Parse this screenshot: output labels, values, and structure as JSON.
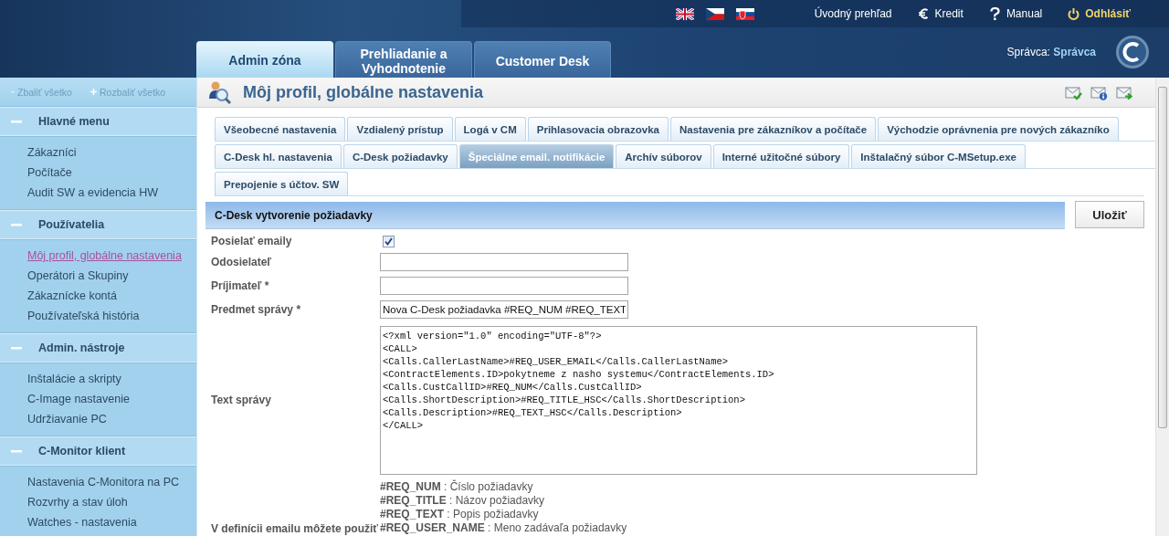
{
  "top_links": [
    {
      "label": "Úvodný prehľad",
      "kind": "plain"
    },
    {
      "label": "Kredit",
      "kind": "euro"
    },
    {
      "label": "Manual",
      "kind": "help"
    },
    {
      "label": "Odhlásiť",
      "kind": "logout"
    }
  ],
  "main_tabs": [
    {
      "label": "Admin zóna",
      "selected": true
    },
    {
      "label": "Prehliadanie a Vyhodnotenie",
      "selected": false
    },
    {
      "label": "Customer Desk",
      "selected": false
    }
  ],
  "user": {
    "role": "Správca:",
    "name": "Správca"
  },
  "sidebar": {
    "collapse_all": "Zbaliť všetko",
    "expand_all": "Rozbaliť všetko",
    "sections": [
      {
        "title": "Hlavné menu",
        "expanded": true,
        "items": [
          {
            "label": "Zákazníci",
            "selected": false
          },
          {
            "label": "Počítače",
            "selected": false
          },
          {
            "label": "Audit SW a evidencia HW",
            "selected": false
          }
        ]
      },
      {
        "title": "Používatelia",
        "expanded": true,
        "items": [
          {
            "label": "Môj profil, globálne nastavenia",
            "selected": true
          },
          {
            "label": "Operátori a Skupiny",
            "selected": false
          },
          {
            "label": "Zákaznícke kontá",
            "selected": false
          },
          {
            "label": "Používateľská história",
            "selected": false
          }
        ]
      },
      {
        "title": "Admin. nástroje",
        "expanded": true,
        "items": [
          {
            "label": "Inštalácie a skripty",
            "selected": false
          },
          {
            "label": "C-Image nastavenie",
            "selected": false
          },
          {
            "label": "Udržiavanie PC",
            "selected": false
          }
        ]
      },
      {
        "title": "C-Monitor klient",
        "expanded": true,
        "items": [
          {
            "label": "Nastavenia C-Monitora na PC",
            "selected": false
          },
          {
            "label": "Rozvrhy a stav úloh",
            "selected": false
          },
          {
            "label": "Watches - nastavenia",
            "selected": false
          }
        ]
      }
    ]
  },
  "page": {
    "title": "Môj profil, globálne nastavenia",
    "tab_rows": [
      [
        {
          "label": "Všeobecné nastavenia",
          "selected": false
        },
        {
          "label": "Vzdialený prístup",
          "selected": false
        },
        {
          "label": "Logá v CM",
          "selected": false
        },
        {
          "label": "Prihlasovacia obrazovka",
          "selected": false
        },
        {
          "label": "Nastavenia pre zákazníkov a počítače",
          "selected": false
        },
        {
          "label": "Východzie oprávnenia pre nových zákazníko",
          "selected": false
        }
      ],
      [
        {
          "label": "C-Desk hl. nastavenia",
          "selected": false
        },
        {
          "label": "C-Desk požiadavky",
          "selected": false
        },
        {
          "label": "Špeciálne email. notifikácie",
          "selected": true
        },
        {
          "label": "Archív súborov",
          "selected": false
        },
        {
          "label": "Interné užitočné súbory",
          "selected": false
        },
        {
          "label": "Inštalačný súbor C-MSetup.exe",
          "selected": false
        }
      ],
      [
        {
          "label": "Prepojenie s účtov. SW",
          "selected": false
        }
      ]
    ],
    "section": {
      "title": "C-Desk vytvorenie požiadavky",
      "save": "Uložiť",
      "fields": [
        {
          "kind": "checkbox",
          "label": "Posielať emaily",
          "checked": true
        },
        {
          "kind": "text",
          "label": "Odosielateľ"
        },
        {
          "kind": "text",
          "label": "Príjimateľ *"
        },
        {
          "kind": "text",
          "label": "Predmet správy *",
          "value": "Nova C-Desk požiadavka #REQ_NUM #REQ_TEXT"
        },
        {
          "kind": "textarea",
          "label": "Text správy",
          "lines": [
            "<?xml version=\"1.0\" encoding=\"UTF-8\"?>",
            "<CALL>",
            "<Calls.CallerLastName>#REQ_USER_EMAIL</Calls.CallerLastName>",
            "<ContractElements.ID>pokytneme z nasho systemu</ContractElements.ID>",
            "<Calls.CustCallID>#REQ_NUM</Calls.CustCallID>",
            "<Calls.ShortDescription>#REQ_TITLE_HSC</Calls.ShortDescription>",
            "<Calls.Description>#REQ_TEXT_HSC</Calls.Description>",
            "</CALL>"
          ]
        },
        {
          "kind": "help",
          "label": "V definícii emailu môžete použiť",
          "items": [
            "**#REQ_NUM** : Číslo požiadavky",
            "**#REQ_TITLE** : Názov požiadavky",
            "**#REQ_TEXT** : Popis požiadavky",
            "**#REQ_USER_NAME** : Meno zadávaľa požiadavky"
          ]
        }
      ]
    }
  }
}
